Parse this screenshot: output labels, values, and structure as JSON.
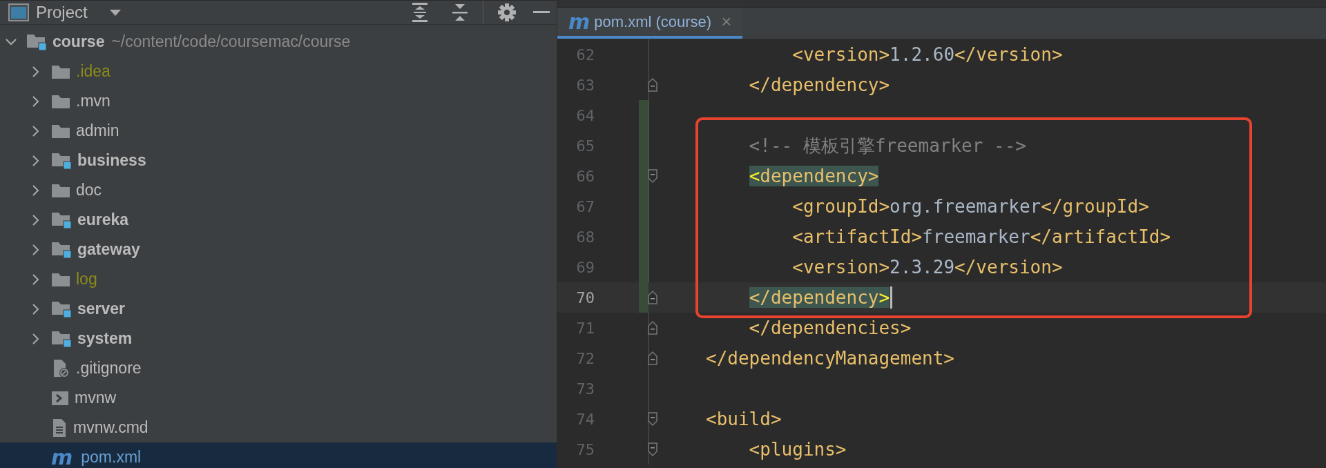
{
  "project_panel": {
    "title": "Project",
    "tree": [
      {
        "name": "course",
        "path": "~/content/code/coursemac/course",
        "kind": "module",
        "expanded": true,
        "selected": false,
        "children": [
          {
            "name": ".idea",
            "kind": "excluded-folder",
            "expanded": false,
            "selected": false
          },
          {
            "name": ".mvn",
            "kind": "folder",
            "expanded": false,
            "selected": false
          },
          {
            "name": "admin",
            "kind": "folder",
            "expanded": false,
            "selected": false
          },
          {
            "name": "business",
            "kind": "module",
            "expanded": false,
            "selected": false
          },
          {
            "name": "doc",
            "kind": "folder",
            "expanded": false,
            "selected": false
          },
          {
            "name": "eureka",
            "kind": "module",
            "expanded": false,
            "selected": false
          },
          {
            "name": "gateway",
            "kind": "module",
            "expanded": false,
            "selected": false
          },
          {
            "name": "log",
            "kind": "excluded-folder",
            "expanded": false,
            "selected": false
          },
          {
            "name": "server",
            "kind": "module",
            "expanded": false,
            "selected": false
          },
          {
            "name": "system",
            "kind": "module",
            "expanded": false,
            "selected": false
          },
          {
            "name": ".gitignore",
            "kind": "ignore-file",
            "selected": false
          },
          {
            "name": "mvnw",
            "kind": "script",
            "selected": false
          },
          {
            "name": "mvnw.cmd",
            "kind": "text-file",
            "selected": false
          },
          {
            "name": "pom.xml",
            "kind": "maven",
            "icon_text": "m",
            "selected": true
          }
        ]
      }
    ]
  },
  "editor": {
    "tabs": [
      {
        "label": "pom.xml (course)",
        "icon_text": "m",
        "close": "×",
        "selected": true
      }
    ],
    "lines": [
      {
        "number": "62",
        "tokens": [
          {
            "kind": "tag",
            "text": "        <version>"
          },
          {
            "kind": "text",
            "text": "1.2.60"
          },
          {
            "kind": "tag",
            "text": "</version>"
          }
        ]
      },
      {
        "number": "63",
        "fold_close": true,
        "tokens": [
          {
            "kind": "tag",
            "text": "    </dependency>"
          }
        ]
      },
      {
        "number": "64",
        "changed": true
      },
      {
        "number": "65",
        "changed": true,
        "annotated": true,
        "tokens": [
          {
            "kind": "comment",
            "text": "    <!-- 模板引擎freemarker -->"
          }
        ]
      },
      {
        "number": "66",
        "changed": true,
        "annotated": true,
        "fold_open": true,
        "matched": true,
        "tokens": [
          {
            "kind": "tag-bright",
            "text": "    <"
          },
          {
            "kind": "tag",
            "text": "dependency>"
          }
        ]
      },
      {
        "number": "67",
        "changed": true,
        "annotated": true,
        "tokens": [
          {
            "kind": "tag",
            "text": "        <groupId>"
          },
          {
            "kind": "text",
            "text": "org.freemarker"
          },
          {
            "kind": "tag",
            "text": "</groupId>"
          }
        ]
      },
      {
        "number": "68",
        "changed": true,
        "annotated": true,
        "tokens": [
          {
            "kind": "tag",
            "text": "        <artifactId>"
          },
          {
            "kind": "text",
            "text": "freemarker"
          },
          {
            "kind": "tag",
            "text": "</artifactId>"
          }
        ]
      },
      {
        "number": "69",
        "changed": true,
        "annotated": true,
        "tokens": [
          {
            "kind": "tag",
            "text": "        <version>"
          },
          {
            "kind": "text",
            "text": "2.3.29"
          },
          {
            "kind": "tag",
            "text": "</version>"
          }
        ]
      },
      {
        "number": "70",
        "changed": true,
        "annotated": true,
        "current": true,
        "caret": true,
        "fold_close": true,
        "matched": true,
        "tokens": [
          {
            "kind": "tag",
            "text": "    </dependency"
          },
          {
            "kind": "tag-bright",
            "text": ">"
          }
        ]
      },
      {
        "number": "71",
        "fold_close": true,
        "tokens": [
          {
            "kind": "tag",
            "text": "    </dependencies>"
          }
        ]
      },
      {
        "number": "72",
        "fold_close": true,
        "tokens": [
          {
            "kind": "tag",
            "text": "</dependencyManagement>"
          }
        ]
      },
      {
        "number": "73"
      },
      {
        "number": "74",
        "fold_open": true,
        "tokens": [
          {
            "kind": "tag",
            "text": "<build>"
          }
        ]
      },
      {
        "number": "75",
        "fold_open": true,
        "tokens": [
          {
            "kind": "tag",
            "text": "    <plugins>"
          }
        ]
      }
    ]
  }
}
